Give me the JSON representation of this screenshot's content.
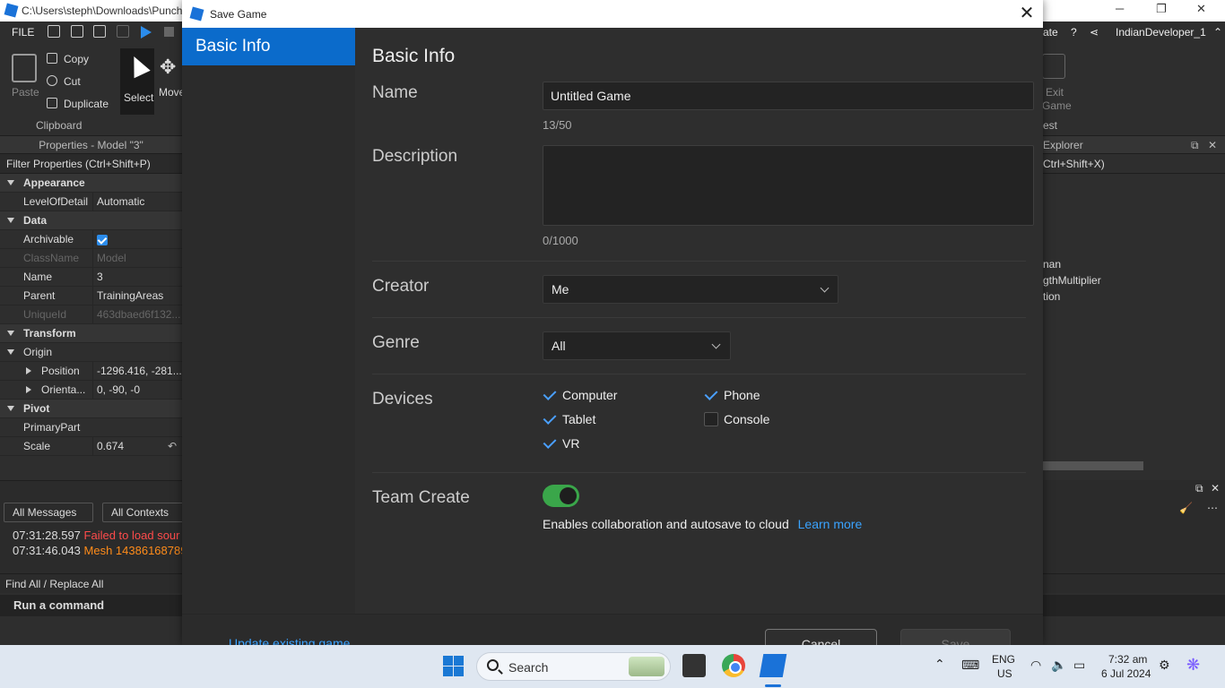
{
  "studio": {
    "window_path": "C:\\Users\\steph\\Downloads\\Punch",
    "menu_file": "FILE",
    "menu_right_fragment": "ate",
    "username": "IndianDeveloper_1",
    "ribbon": {
      "paste": "Paste",
      "copy": "Copy",
      "cut": "Cut",
      "duplicate": "Duplicate",
      "clipboard": "Clipboard",
      "select": "Select",
      "move": "Move",
      "exit_game_1": "Exit",
      "exit_game_2": "Game",
      "test_fragment": "est"
    },
    "properties": {
      "title": "Properties - Model \"3\"",
      "filter": "Filter Properties (Ctrl+Shift+P)",
      "rows": [
        {
          "type": "section",
          "key": "Appearance"
        },
        {
          "type": "prop",
          "key": "LevelOfDetail",
          "value": "Automatic"
        },
        {
          "type": "section",
          "key": "Data"
        },
        {
          "type": "check",
          "key": "Archivable",
          "value": "true"
        },
        {
          "type": "dim",
          "key": "ClassName",
          "value": "Model"
        },
        {
          "type": "prop",
          "key": "Name",
          "value": "3"
        },
        {
          "type": "prop",
          "key": "Parent",
          "value": "TrainingAreas"
        },
        {
          "type": "dim",
          "key": "UniqueId",
          "value": "463dbaed6f132..."
        },
        {
          "type": "section",
          "key": "Transform"
        },
        {
          "type": "subsection",
          "key": "Origin",
          "value": ""
        },
        {
          "type": "child",
          "key": "Position",
          "value": "-1296.416, -281...."
        },
        {
          "type": "child",
          "key": "Orienta...",
          "value": "0, -90, -0"
        },
        {
          "type": "section",
          "key": "Pivot"
        },
        {
          "type": "prop",
          "key": "PrimaryPart",
          "value": ""
        },
        {
          "type": "prop",
          "key": "Scale",
          "value": "0.674"
        }
      ]
    },
    "explorer": {
      "title": "Explorer",
      "filter": "Ctrl+Shift+X)",
      "items": [
        "nan",
        "gthMultiplier",
        "tion"
      ]
    },
    "output": {
      "all_messages": "All Messages",
      "all_contexts": "All Contexts",
      "lines": [
        {
          "time": "07:31:28.597",
          "msg": "Failed to load sour",
          "level": "error"
        },
        {
          "time": "07:31:46.043",
          "msg": "Mesh 14386168789",
          "level": "warning"
        }
      ],
      "find_replace": "Find All / Replace All",
      "command": "Run a command"
    }
  },
  "dialog": {
    "title": "Save Game",
    "close": "✕",
    "sidebar": [
      "Basic Info"
    ],
    "heading": "Basic Info",
    "name_label": "Name",
    "name_value": "Untitled Game",
    "name_count": "13/50",
    "description_label": "Description",
    "description_value": "",
    "description_count": "0/1000",
    "creator_label": "Creator",
    "creator_value": "Me",
    "genre_label": "Genre",
    "genre_value": "All",
    "devices_label": "Devices",
    "devices": {
      "computer": {
        "label": "Computer",
        "checked": true
      },
      "phone": {
        "label": "Phone",
        "checked": true
      },
      "tablet": {
        "label": "Tablet",
        "checked": true
      },
      "console": {
        "label": "Console",
        "checked": false
      },
      "vr": {
        "label": "VR",
        "checked": true
      }
    },
    "team_create_label": "Team Create",
    "team_create_on": true,
    "collab_text": "Enables collaboration and autosave to cloud",
    "learn_more": "Learn more",
    "update_existing": "Update existing game",
    "cancel": "Cancel",
    "save": "Save"
  },
  "taskbar": {
    "search": "Search",
    "lang1": "ENG",
    "lang2": "US",
    "time": "7:32 am",
    "date": "6 Jul 2024"
  },
  "colors": {
    "accent": "#0b6bcb",
    "link": "#3aa3ff",
    "toggle_on": "#3aa64a",
    "error": "#ff4b4b",
    "warning": "#ff8c1a"
  }
}
